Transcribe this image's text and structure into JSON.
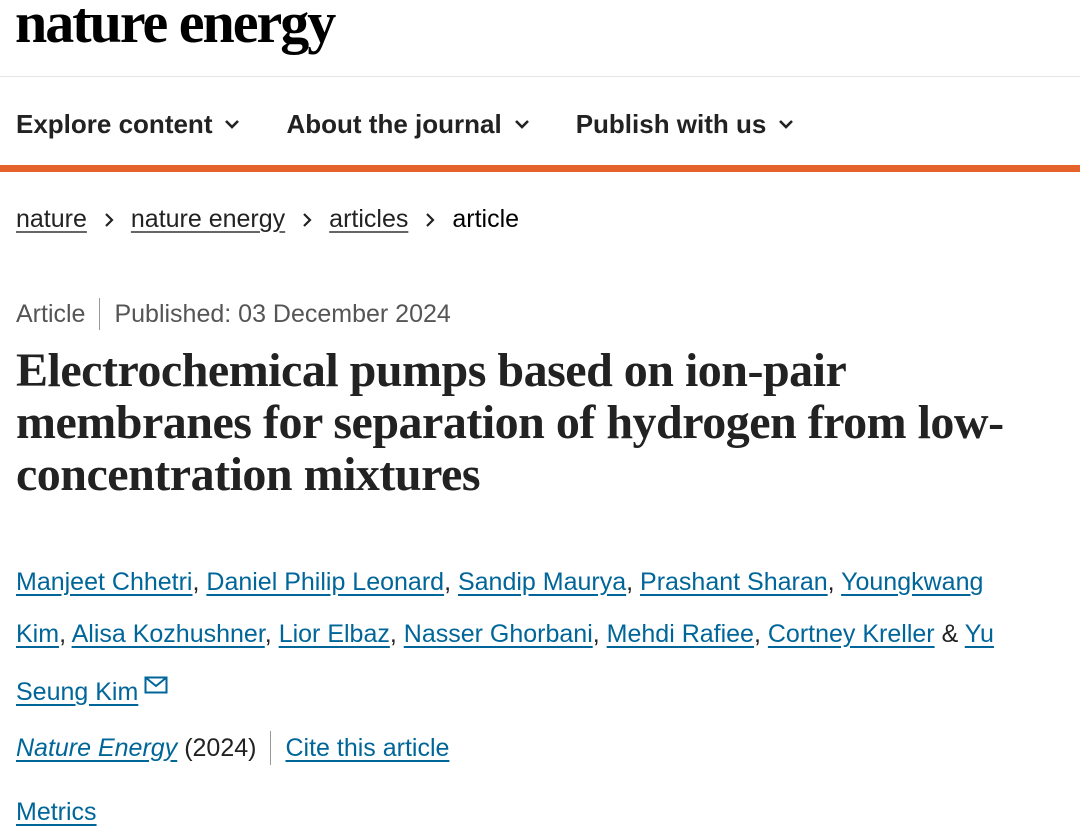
{
  "header": {
    "brand": "nature energy"
  },
  "nav": {
    "items": [
      {
        "label": "Explore content",
        "icon": "chevron-down-icon"
      },
      {
        "label": "About the journal",
        "icon": "chevron-down-icon"
      },
      {
        "label": "Publish with us",
        "icon": "chevron-down-icon"
      }
    ]
  },
  "breadcrumb": {
    "items": [
      "nature",
      "nature energy",
      "articles"
    ],
    "current": "article",
    "separator_icon": "chevron-right-icon"
  },
  "article": {
    "type": "Article",
    "published": "Published: 03 December 2024",
    "title": "Electrochemical pumps based on ion-pair membranes for separation of hydrogen from low-concentration mixtures",
    "authors": [
      "Manjeet Chhetri",
      "Daniel Philip Leonard",
      "Sandip Maurya",
      "Prashant Sharan",
      "Youngkwang Kim",
      "Alisa Kozhushner",
      "Lior Elbaz",
      "Nasser Ghorbani",
      "Mehdi Rafiee",
      "Cortney Kreller",
      "Yu Seung Kim"
    ],
    "author_separator": ",",
    "last_author_joiner": "&",
    "corresponding_icon": "envelope-icon",
    "journal": "Nature Energy",
    "year": "(2024)",
    "cite_label": "Cite this article",
    "metrics_label": "Metrics"
  },
  "colors": {
    "accent_bar": "#e5632b",
    "link": "#006699",
    "text": "#222222"
  }
}
